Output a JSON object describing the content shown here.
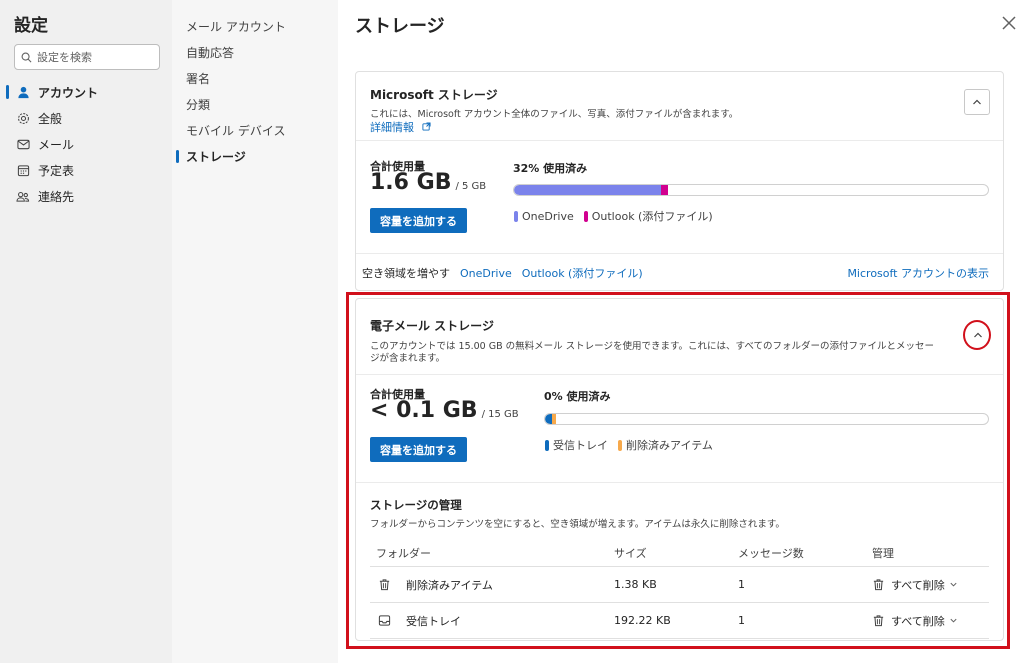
{
  "left_nav": {
    "title": "設定",
    "search_placeholder": "設定を検索",
    "items": [
      {
        "label": "アカウント",
        "icon": "person-icon"
      },
      {
        "label": "全般",
        "icon": "gear-icon"
      },
      {
        "label": "メール",
        "icon": "mail-icon"
      },
      {
        "label": "予定表",
        "icon": "calendar-icon"
      },
      {
        "label": "連絡先",
        "icon": "people-icon"
      }
    ]
  },
  "sub_nav": {
    "items": [
      "メール アカウント",
      "自動応答",
      "署名",
      "分類",
      "モバイル デバイス",
      "ストレージ"
    ]
  },
  "main": {
    "title": "ストレージ",
    "microsoft_storage": {
      "heading": "Microsoft ストレージ",
      "description": "これには、Microsoft アカウント全体のファイル、写真、添付ファイルが含まれます。",
      "learn_more": "詳細情報",
      "total_label": "合計使用量",
      "total_value": "1.6 GB",
      "total_capacity": "/ 5 GB",
      "add_button": "容量を追加する",
      "used_label": "32% 使用済み",
      "used_percent": 32,
      "segments": [
        {
          "label": "OneDrive",
          "percent": 31,
          "color": "#7b83eb"
        },
        {
          "label": "Outlook (添付ファイル)",
          "percent": 1.5,
          "color": "#d1008f"
        }
      ],
      "free_space_label": "空き領域を増やす",
      "free_links": [
        "OneDrive",
        "Outlook (添付ファイル)"
      ],
      "account_link": "Microsoft アカウントの表示"
    },
    "email_storage": {
      "heading": "電子メール ストレージ",
      "description": "このアカウントでは 15.00 GB の無料メール ストレージを使用できます。これには、すべてのフォルダーの添付ファイルとメッセージが含まれます。",
      "total_label": "合計使用量",
      "total_value": "< 0.1 GB",
      "total_capacity": "/ 15 GB",
      "add_button": "容量を追加する",
      "used_label": "0% 使用済み",
      "used_percent": 0,
      "segments": [
        {
          "label": "受信トレイ",
          "percent": 1.5,
          "color": "#0f6cbd"
        },
        {
          "label": "削除済みアイテム",
          "percent": 1,
          "color": "#f7a94b"
        }
      ],
      "manage": {
        "title": "ストレージの管理",
        "description": "フォルダーからコンテンツを空にすると、空き領域が増えます。アイテムは永久に削除されます。",
        "columns": [
          "フォルダー",
          "サイズ",
          "メッセージ数",
          "管理"
        ],
        "rows": [
          {
            "icon": "trash-icon",
            "folder": "削除済みアイテム",
            "size": "1.38 KB",
            "count": "1",
            "action": "すべて削除"
          },
          {
            "icon": "inbox-icon",
            "folder": "受信トレイ",
            "size": "192.22 KB",
            "count": "1",
            "action": "すべて削除"
          }
        ]
      }
    }
  },
  "colors": {
    "accent": "#0f6cbd",
    "highlight": "#d1101b"
  }
}
